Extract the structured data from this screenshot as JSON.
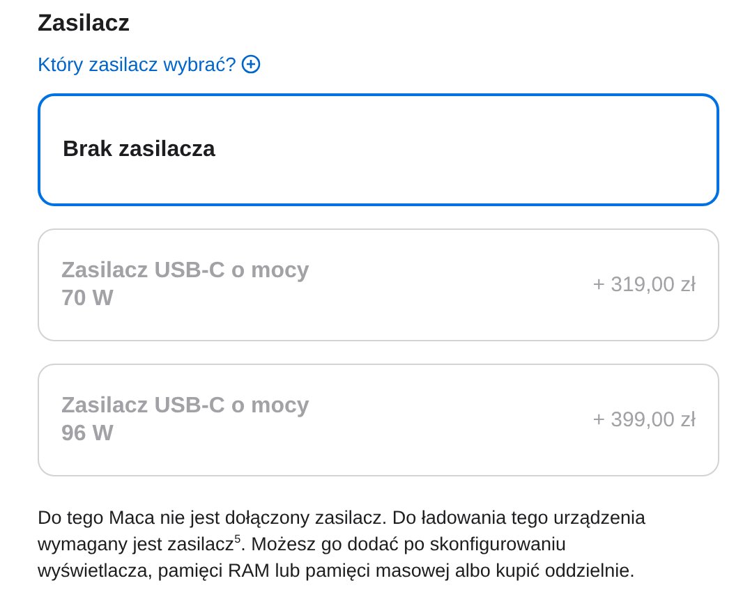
{
  "heading": "Zasilacz",
  "help_link": "Który zasilacz wybrać?",
  "options": [
    {
      "name": "Brak zasilacza",
      "selected": true,
      "disabled": false
    },
    {
      "name": "Zasilacz USB-C o mocy 70 W",
      "price": "+ 319,00 zł",
      "selected": false,
      "disabled": true
    },
    {
      "name": "Zasilacz USB-C o mocy 96 W",
      "price": "+ 399,00 zł",
      "selected": false,
      "disabled": true
    }
  ],
  "note": "Do tego Maca nie jest dołączony zasilacz. Do ładowania tego urządzenia wymagany jest zasilacz$^{5}$. Możesz go dodać po skonfigurowaniu wyświetlacza, pamięci RAM lub pamięci masowej albo kupić oddzielnie."
}
